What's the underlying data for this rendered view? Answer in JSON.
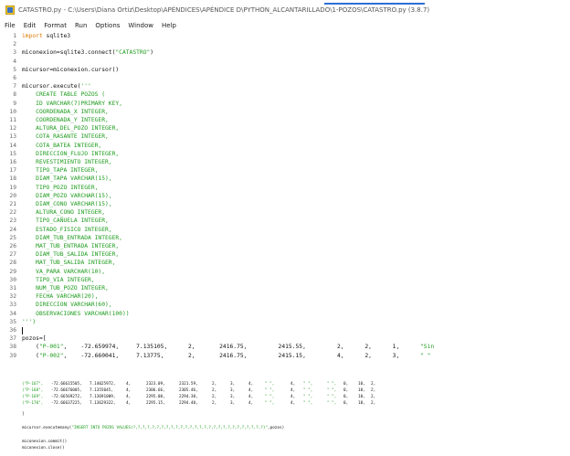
{
  "window": {
    "title": "CATASTRO.py - C:\\Users\\Diana Ortiz\\Desktop\\APÉNDICES\\APÉNDICE D\\PYTHON_ALCANTARILLADO\\1-POZOS\\CATASTRO.py (3.8.7)"
  },
  "menubar": {
    "items": [
      "File",
      "Edit",
      "Format",
      "Run",
      "Options",
      "Window",
      "Help"
    ]
  },
  "editor": {
    "lines": [
      {
        "n": "1",
        "segments": [
          {
            "t": "import",
            "c": "kw"
          },
          {
            "t": " sqlite3",
            "c": "plain"
          }
        ]
      },
      {
        "n": "2",
        "segments": []
      },
      {
        "n": "3",
        "segments": [
          {
            "t": "miconexion=sqlite3.connect(",
            "c": "plain"
          },
          {
            "t": "\"CATASTRO\"",
            "c": "str"
          },
          {
            "t": ")",
            "c": "plain"
          }
        ]
      },
      {
        "n": "4",
        "segments": []
      },
      {
        "n": "5",
        "segments": [
          {
            "t": "micursor=miconexion.cursor()",
            "c": "plain"
          }
        ]
      },
      {
        "n": "6",
        "segments": []
      },
      {
        "n": "7",
        "segments": [
          {
            "t": "micursor.execute(",
            "c": "plain"
          },
          {
            "t": "'''",
            "c": "str"
          }
        ]
      },
      {
        "n": "8",
        "segments": [
          {
            "t": "    CREATE TABLE POZOS (",
            "c": "str"
          }
        ]
      },
      {
        "n": "9",
        "segments": [
          {
            "t": "    ID VARCHAR(7)PRIMARY KEY,",
            "c": "str"
          }
        ]
      },
      {
        "n": "10",
        "segments": [
          {
            "t": "    COORDENADA_X INTEGER,",
            "c": "str"
          }
        ]
      },
      {
        "n": "11",
        "segments": [
          {
            "t": "    COORDENADA_Y INTEGER,",
            "c": "str"
          }
        ]
      },
      {
        "n": "12",
        "segments": [
          {
            "t": "    ALTURA_DEL_POZO INTEGER,",
            "c": "str"
          }
        ]
      },
      {
        "n": "13",
        "segments": [
          {
            "t": "    COTA_RASANTE INTEGER,",
            "c": "str"
          }
        ]
      },
      {
        "n": "14",
        "segments": [
          {
            "t": "    COTA_BATEA INTEGER,",
            "c": "str"
          }
        ]
      },
      {
        "n": "15",
        "segments": [
          {
            "t": "    DIRECCION_FLUJO INTEGER,",
            "c": "str"
          }
        ]
      },
      {
        "n": "16",
        "segments": [
          {
            "t": "    REVESTIMIENTO INTEGER,",
            "c": "str"
          }
        ]
      },
      {
        "n": "17",
        "segments": [
          {
            "t": "    TIPO_TAPA INTEGER,",
            "c": "str"
          }
        ]
      },
      {
        "n": "18",
        "segments": [
          {
            "t": "    DIAM_TAPA VARCHAR(15),",
            "c": "str"
          }
        ]
      },
      {
        "n": "19",
        "segments": [
          {
            "t": "    TIPO_POZO INTEGER,",
            "c": "str"
          }
        ]
      },
      {
        "n": "20",
        "segments": [
          {
            "t": "    DIAM_POZO VARCHAR(15),",
            "c": "str"
          }
        ]
      },
      {
        "n": "21",
        "segments": [
          {
            "t": "    DIAM_CONO VARCHAR(15),",
            "c": "str"
          }
        ]
      },
      {
        "n": "22",
        "segments": [
          {
            "t": "    ALTURA_CONO INTEGER,",
            "c": "str"
          }
        ]
      },
      {
        "n": "23",
        "segments": [
          {
            "t": "    TIPO_CAÑUELA INTEGER,",
            "c": "str"
          }
        ]
      },
      {
        "n": "24",
        "segments": [
          {
            "t": "    ESTADO_FISICO INTEGER,",
            "c": "str"
          }
        ]
      },
      {
        "n": "25",
        "segments": [
          {
            "t": "    DIAM_TUB_ENTRADA INTEGER,",
            "c": "str"
          }
        ]
      },
      {
        "n": "26",
        "segments": [
          {
            "t": "    MAT_TUB_ENTRADA INTEGER,",
            "c": "str"
          }
        ]
      },
      {
        "n": "27",
        "segments": [
          {
            "t": "    DIAM_TUB_SALIDA INTEGER,",
            "c": "str"
          }
        ]
      },
      {
        "n": "28",
        "segments": [
          {
            "t": "    MAT_TUB_SALIDA INTEGER,",
            "c": "str"
          }
        ]
      },
      {
        "n": "29",
        "segments": [
          {
            "t": "    VA_PARA VARCHAR(10),",
            "c": "str"
          }
        ]
      },
      {
        "n": "30",
        "segments": [
          {
            "t": "    TIPO_VIA INTEGER,",
            "c": "str"
          }
        ]
      },
      {
        "n": "31",
        "segments": [
          {
            "t": "    NUM_TUB_POZO INTEGER,",
            "c": "str"
          }
        ]
      },
      {
        "n": "32",
        "segments": [
          {
            "t": "    FECHA VARCHAR(20),",
            "c": "str"
          }
        ]
      },
      {
        "n": "33",
        "segments": [
          {
            "t": "    DIRECCION VARCHAR(60),",
            "c": "str"
          }
        ]
      },
      {
        "n": "34",
        "segments": [
          {
            "t": "    OBSERVACIONES VARCHAR(100))",
            "c": "str"
          }
        ]
      },
      {
        "n": "35",
        "segments": [
          {
            "t": "''')",
            "c": "str"
          }
        ]
      },
      {
        "n": "36",
        "segments": []
      },
      {
        "n": "37",
        "segments": [
          {
            "t": "pozos=[",
            "c": "plain"
          }
        ]
      },
      {
        "n": "38",
        "segments": [
          {
            "t": "    (",
            "c": "plain"
          },
          {
            "t": "\"P-001\"",
            "c": "str"
          },
          {
            "t": ",    -72.659974,     7.135105,      2,       2416.75,         2415.55,         2,      2,      1,      ",
            "c": "plain"
          },
          {
            "t": "\"Sin",
            "c": "str"
          }
        ]
      },
      {
        "n": "39",
        "segments": [
          {
            "t": "    (",
            "c": "plain"
          },
          {
            "t": "\"P-002\"",
            "c": "str"
          },
          {
            "t": ",    -72.660041,     7.13775,       2,       2416.75,         2415.15,         4,      2,      3,      ",
            "c": "plain"
          },
          {
            "t": "\" \"",
            "c": "str"
          }
        ]
      }
    ]
  },
  "lower": {
    "rows": [
      {
        "id": "(\"P-167\",",
        "cx": "-72.66615505,",
        "cy": "7.14025972,",
        "a": "4,",
        "r": "2323.09,",
        "b": "2321.59,",
        "c1": "2,",
        "c2": "3,",
        "c3": "4,",
        "s1": "\" \",",
        "c4": "4,",
        "s2": "\" \",",
        "s3": "\" \",",
        "c5": "0,",
        "c6": "10,",
        "c7": "2,"
      },
      {
        "id": "(\"P-168\",",
        "cx": "-72.66676005,",
        "cy": "7.1355045,",
        "a": "4,",
        "r": "2306.66,",
        "b": "2305.46,",
        "c1": "2,",
        "c2": "3,",
        "c3": "4,",
        "s1": "\" \",",
        "c4": "4,",
        "s2": "\" \",",
        "s3": "\" \",",
        "c5": "0,",
        "c6": "10,",
        "c7": "2,"
      },
      {
        "id": "(\"P-169\",",
        "cx": "-72.66569272,",
        "cy": "7.13691009,",
        "a": "4,",
        "r": "2295.00,",
        "b": "2294.30,",
        "c1": "2,",
        "c2": "3,",
        "c3": "4,",
        "s1": "\" \",",
        "c4": "4,",
        "s2": "\" \",",
        "s3": "\" \",",
        "c5": "0,",
        "c6": "10,",
        "c7": "2,"
      },
      {
        "id": "(\"P-170\",",
        "cx": "-72.66637225,",
        "cy": "7.13629322,",
        "a": "4,",
        "r": "2295.15,",
        "b": "2294.40,",
        "c1": "2,",
        "c2": "3,",
        "c3": "4,",
        "s1": "\" \",",
        "c4": "4,",
        "s2": "\" \",",
        "s3": "\" \",",
        "c5": "0,",
        "c6": "10,",
        "c7": "2,"
      }
    ],
    "close_bracket": "]",
    "executemany": {
      "before": "micursor.executemany(",
      "sql": "\"INSERT INTO POZOS VALUES(?,?,?,?,?,?,?,?,?,?,?,?,?,?,?,?,?,?,?,?,?,?,?,?,?,?,?,?)\"",
      "after": ",pozos)"
    },
    "commit": "miconexion.commit()",
    "close": "miconexion.close()"
  },
  "colors": {
    "keyword": "#e07a00",
    "string": "#1d9b1d",
    "text": "#111111",
    "line_number": "#666666"
  }
}
